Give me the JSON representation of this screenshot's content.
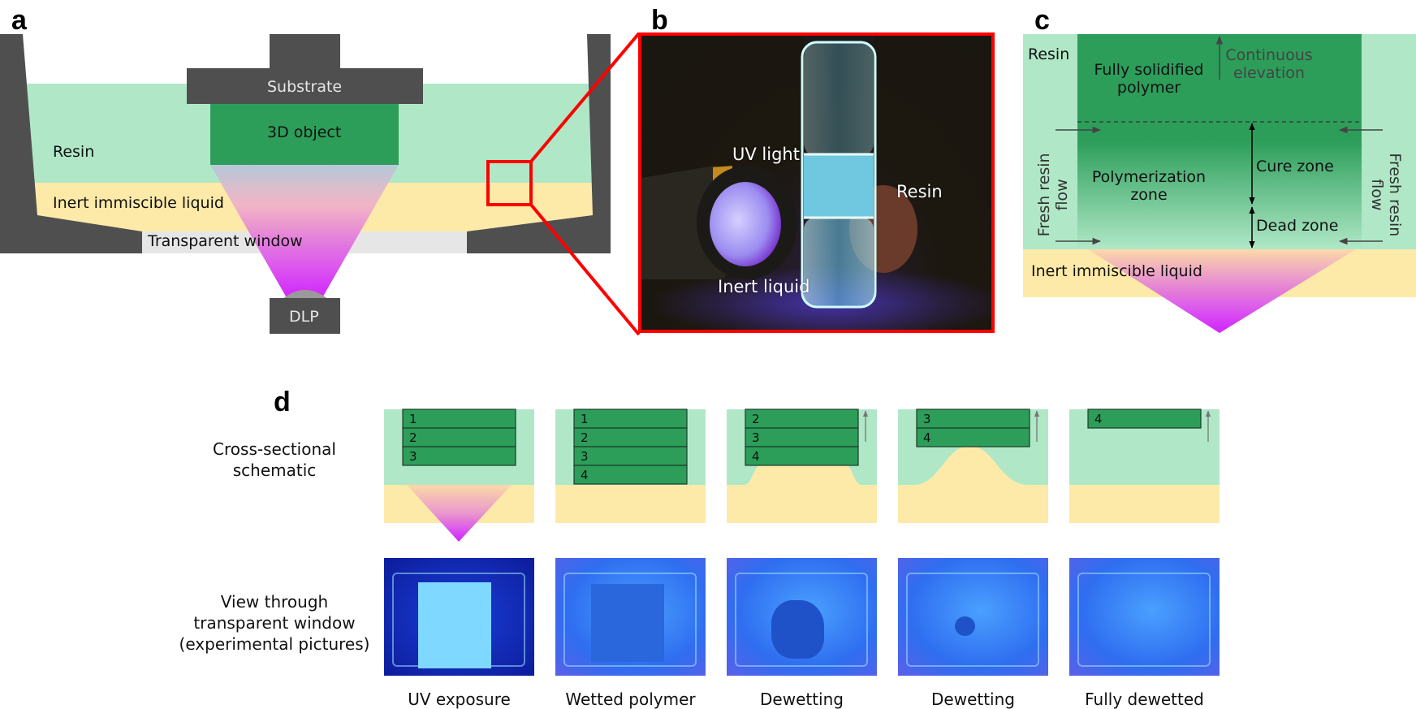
{
  "colors": {
    "resin": "#b0e8c7",
    "polymer": "#2c9e5a",
    "inert_liquid": "#fdeaa8",
    "frame": "#4f4f4f",
    "window": "#e6e6e6",
    "uv_top": "#b8c6d9",
    "uv_bottom": "#cc10ff",
    "highlight_red": "#ff0000"
  },
  "panel_a": {
    "label": "a",
    "substrate": "Substrate",
    "object": "3D object",
    "resin": "Resin",
    "inert": "Inert immiscible liquid",
    "window": "Transparent window",
    "dlp": "DLP"
  },
  "panel_b": {
    "label": "b",
    "uv_light": "UV light",
    "resin": "Resin",
    "inert": "Inert liquid"
  },
  "panel_c": {
    "label": "c",
    "resin": "Resin",
    "solid_line1": "Fully solidified",
    "solid_line2": "polymer",
    "elev_line1": "Continuous",
    "elev_line2": "elevation",
    "poly_line1": "Polymerization",
    "poly_line2": "zone",
    "cure": "Cure zone",
    "dead": "Dead zone",
    "fresh_line1": "Fresh resin",
    "fresh_line2": "flow",
    "inert": "Inert immiscible liquid"
  },
  "panel_d": {
    "label": "d",
    "row1_line1": "Cross-sectional",
    "row1_line2": "schematic",
    "row2_line1": "View through",
    "row2_line2": "transparent window",
    "row2_line3": "(experimental pictures)",
    "steps": [
      {
        "caption": "UV exposure",
        "layers": [
          "1",
          "2",
          "3"
        ]
      },
      {
        "caption": "Wetted polymer",
        "layers": [
          "1",
          "2",
          "3",
          "4"
        ]
      },
      {
        "caption": "Dewetting",
        "layers": [
          "2",
          "3",
          "4"
        ]
      },
      {
        "caption": "Dewetting",
        "layers": [
          "3",
          "4"
        ]
      },
      {
        "caption": "Fully dewetted",
        "layers": [
          "4"
        ]
      }
    ]
  }
}
